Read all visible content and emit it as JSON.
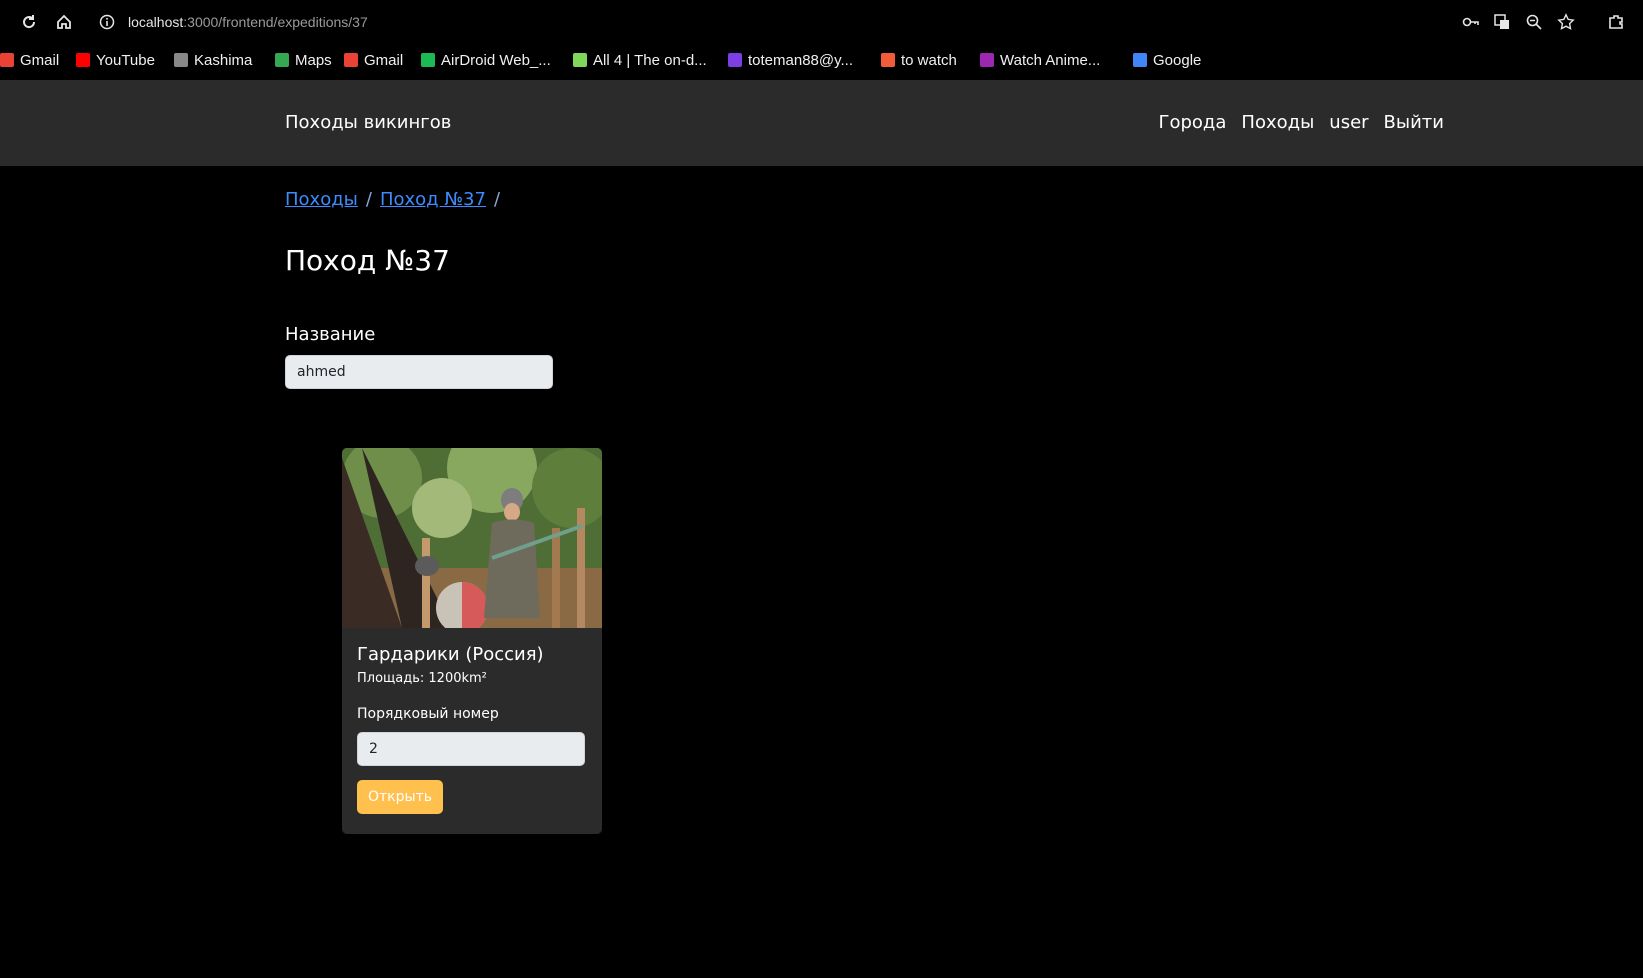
{
  "browser": {
    "url_host": "localhost",
    "url_path": ":3000/frontend/expeditions/37",
    "bookmarks": [
      {
        "label": "Gmail",
        "icon": "gmail-icon",
        "color": "#EA4335"
      },
      {
        "label": "YouTube",
        "icon": "youtube-icon",
        "color": "#FF0000"
      },
      {
        "label": "Kashima",
        "icon": "globe-icon",
        "color": "#888888"
      },
      {
        "label": "Maps",
        "icon": "maps-icon",
        "color": "#34A853"
      },
      {
        "label": "Gmail",
        "icon": "gmail-icon",
        "color": "#EA4335"
      },
      {
        "label": "AirDroid Web_...",
        "icon": "airdroid-icon",
        "color": "#1DB954"
      },
      {
        "label": "All 4 | The on-d...",
        "icon": "all4-icon",
        "color": "#7FD858"
      },
      {
        "label": "toteman88@y...",
        "icon": "mail-icon",
        "color": "#7B3FE4"
      },
      {
        "label": "to watch",
        "icon": "video-icon",
        "color": "#F25C3A"
      },
      {
        "label": "Watch Anime...",
        "icon": "play-icon",
        "color": "#9C27B0"
      },
      {
        "label": "Google",
        "icon": "google-icon",
        "color": "#4285F4"
      }
    ]
  },
  "navbar": {
    "brand": "Походы викингов",
    "links": [
      "Города",
      "Походы",
      "user",
      "Выйти"
    ]
  },
  "breadcrumb": {
    "items": [
      "Походы",
      "Поход №37"
    ],
    "separator": "/"
  },
  "page": {
    "title": "Поход №37",
    "name_label": "Название",
    "name_value": "ahmed"
  },
  "card": {
    "title": "Гардарики (Россия)",
    "area_text": "Площадь: 1200km²",
    "order_label": "Порядковый номер",
    "order_value": "2",
    "open_button": "Открыть"
  },
  "colors": {
    "navbar_bg": "#2B2B2B",
    "link": "#3D8BFD",
    "button": "#FFC04D"
  }
}
